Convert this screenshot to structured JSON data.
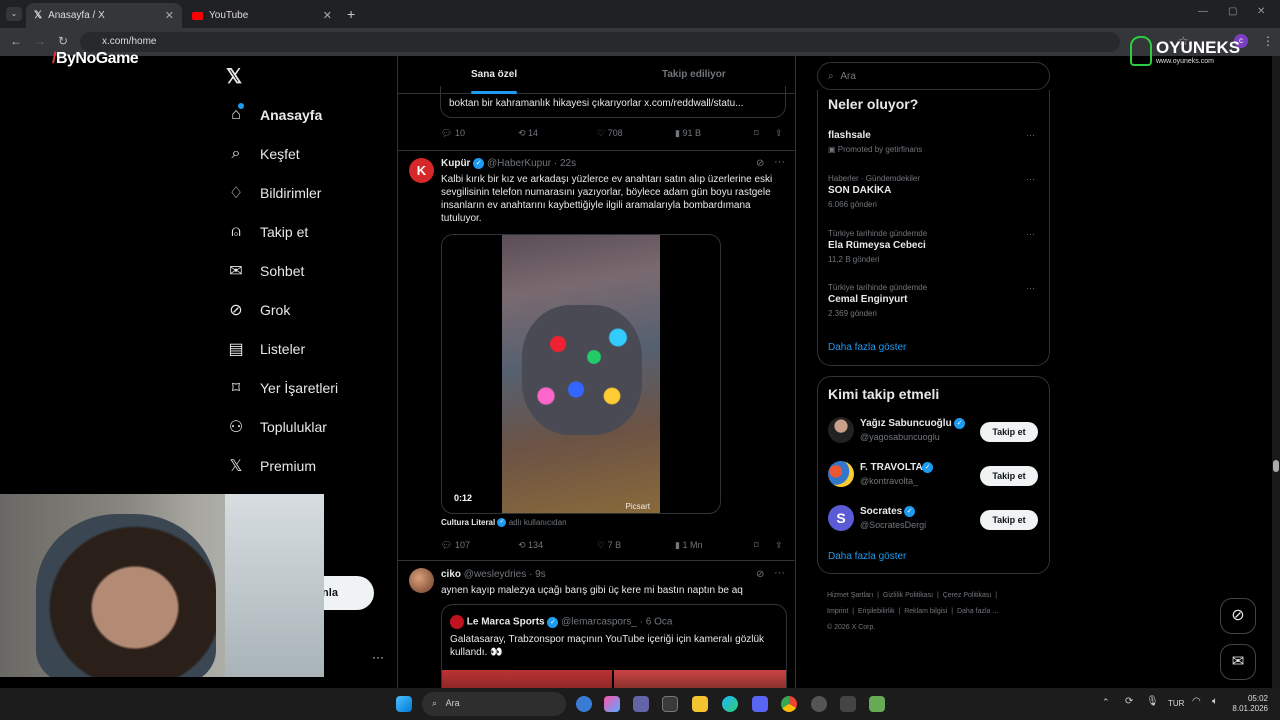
{
  "browser": {
    "tabs": [
      {
        "title": "Anasayfa / X"
      },
      {
        "title": "YouTube"
      }
    ],
    "url": "x.com/home"
  },
  "overlays": {
    "left_logo": "ByNoGame",
    "right_logo": "OYUNEKS",
    "right_logo_sub": "www.oyuneks.com"
  },
  "sidebar": {
    "items": [
      {
        "label": "Anasayfa",
        "icon": "home-icon"
      },
      {
        "label": "Keşfet",
        "icon": "search-icon"
      },
      {
        "label": "Bildirimler",
        "icon": "bell-icon"
      },
      {
        "label": "Takip et",
        "icon": "person-add-icon"
      },
      {
        "label": "Sohbet",
        "icon": "mail-icon"
      },
      {
        "label": "Grok",
        "icon": "grok-icon"
      },
      {
        "label": "Listeler",
        "icon": "list-icon"
      },
      {
        "label": "Yer İşaretleri",
        "icon": "bookmark-icon"
      },
      {
        "label": "Topluluklar",
        "icon": "communities-icon"
      },
      {
        "label": "Premium",
        "icon": "x-logo-icon"
      }
    ],
    "post_button_partial": "nla"
  },
  "feed": {
    "tabs": [
      "Sana özel",
      "Takip ediliyor"
    ],
    "tweet0": {
      "text": "boktan bir kahramanlık hikayesi çıkarıyorlar x.com/reddwall/statu...",
      "replies": "10",
      "reposts": "14",
      "likes": "708",
      "views": "91 B"
    },
    "tweet1": {
      "name": "Kupür",
      "handle": "@HaberKupur",
      "time": "22s",
      "text": "Kalbi kırık bir kız ve arkadaşı yüzlerce ev anahtarı satın alıp üzerlerine eski sevgilisinin telefon numarasını yazıyorlar, böylece adam gün boyu rastgele insanların ev anahtarını kaybettiğiyle ilgili aramalarıyla bombardımana tutuluyor.",
      "video_duration": "0:12",
      "watermark": "Picsart",
      "source_name": "Cultura Literal",
      "source_suffix": "adlı kullanıcıdan",
      "replies": "107",
      "reposts": "134",
      "likes": "7 B",
      "views": "1 Mn"
    },
    "tweet2": {
      "name": "ciko",
      "handle": "@wesleydries",
      "time": "9s",
      "text": "aynen kayıp malezya uçağı barış gibi üç kere mi bastın naptın be aq",
      "quote": {
        "name": "Le Marca Sports",
        "handle": "@lemarcaspors_",
        "time": "6 Oca",
        "text": "Galatasaray, Trabzonspor maçının YouTube içeriği için kameralı gözlük kullandı. 👀"
      }
    }
  },
  "right": {
    "search_placeholder": "Ara",
    "trends_title": "Neler oluyor?",
    "trends": [
      {
        "meta": "",
        "title": "flashsale",
        "sub": "Promoted by getirfinans"
      },
      {
        "meta": "Haberler · Gündemdekiler",
        "title": "SON DAKİKA",
        "sub": "6.066 gönderi"
      },
      {
        "meta": "Türkiye tarihinde gündemde",
        "title": "Ela Rümeysa Cebeci",
        "sub": "11,2 B gönderi"
      },
      {
        "meta": "Türkiye tarihinde gündemde",
        "title": "Cemal Enginyurt",
        "sub": "2.369 gönderi"
      }
    ],
    "show_more": "Daha fazla göster",
    "who_title": "Kimi takip etmeli",
    "who": [
      {
        "name": "Yağız Sabuncuoğlu",
        "handle": "@yagosabuncuoglu",
        "btn": "Takip et"
      },
      {
        "name": "F. TRAVOLTA",
        "handle": "@kontravolta_",
        "btn": "Takip et"
      },
      {
        "name": "Socrates",
        "handle": "@SocratesDergi",
        "btn": "Takip et"
      }
    ],
    "who_more": "Daha fazla göster",
    "footer": [
      "Hizmet Şartları",
      "Gizlilik Politikası",
      "Çerez Politikası",
      "Imprint",
      "Erişilebilirlik",
      "Reklam bilgisi",
      "Daha fazla ...",
      "© 2026 X Corp."
    ]
  },
  "taskbar": {
    "search": "Ara",
    "lang": "TUR",
    "time": "05:02",
    "date": "8.01.2026"
  }
}
